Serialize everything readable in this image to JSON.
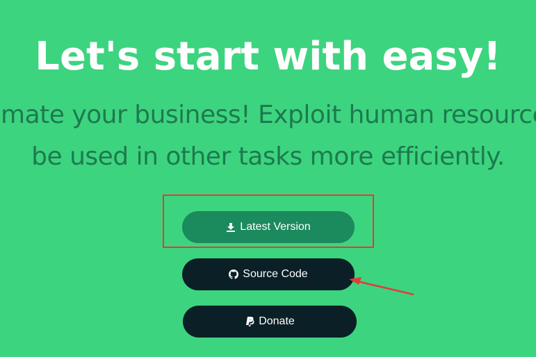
{
  "hero": {
    "headline": "Let's start with easy!",
    "subline_1": "Automate your business! Exploit human resources to",
    "subline_2": "be used in other tasks more efficiently."
  },
  "buttons": {
    "latest_label": "Latest Version",
    "source_label": "Source Code",
    "donate_label": "Donate"
  },
  "icons": {
    "latest": "download-icon",
    "source": "github-icon",
    "donate": "paypal-icon"
  },
  "colors": {
    "background": "#3dd47f",
    "headline": "#ffffff",
    "subline": "#1d7a4f",
    "latest_button": "#1b8a5c",
    "dark_button": "#0b1f26",
    "annotation": "#e23b3b"
  }
}
